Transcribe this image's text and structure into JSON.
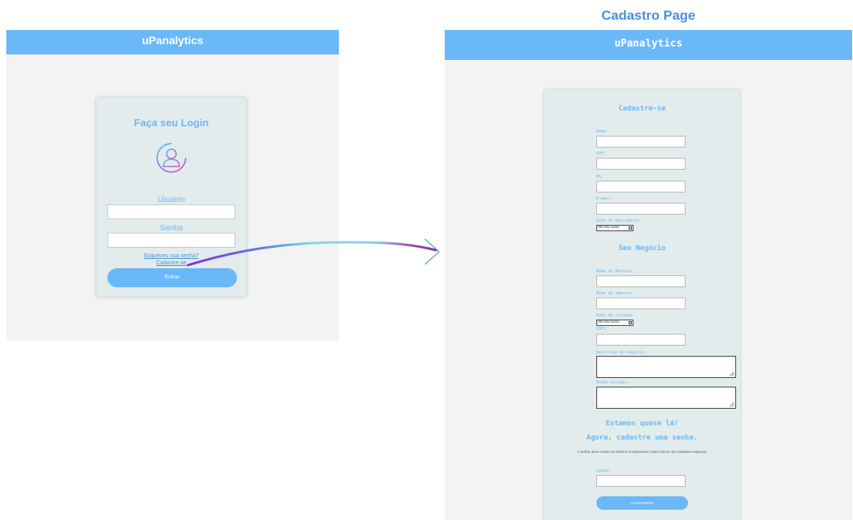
{
  "caption": "Cadastro Page",
  "login": {
    "app_title": "uPanalytics",
    "title": "Faça seu Login",
    "user_label": "Usuário",
    "user_value": "",
    "password_label": "Senha",
    "password_value": "",
    "forgot_link": "Esqueceu sua senha?",
    "signup_link": "Cadastre-se",
    "enter_button": "Entrar",
    "avatar_icon": "user-circle-icon"
  },
  "cadastro": {
    "app_title": "uPanalytics",
    "heading": "Cadastre-se",
    "fields": {
      "nome": "Nome:",
      "cpf": "CPF:",
      "rg": "RG:",
      "email": "E-mail:",
      "nascimento": "Data de Nascimento:",
      "date_placeholder": "dd/mm/aaaa"
    },
    "business_heading": "Seu Negócio",
    "business_fields": {
      "nome_negocio": "Nome do Negócio:",
      "nome_empresa": "Nome da empresa:",
      "data_criacao": "Data de criação:",
      "cnpj": "CNPJ:",
      "descricao": "Descrição do negócio:",
      "redes": "Redes Sociais:"
    },
    "almost": "Estamos quase lá!",
    "now_password": "Agora, cadastre uma senha.",
    "password_note": "A senha deve conter no mínimo 8 caracteres e pelo menos um caractere especial.",
    "password_label": "Senha:",
    "submit_button": "CADASTRAR"
  },
  "colors": {
    "header": "#6ab8f7",
    "card": "#e2ecec",
    "page_bg": "#f3f3f3",
    "caption": "#4a8fe0"
  }
}
